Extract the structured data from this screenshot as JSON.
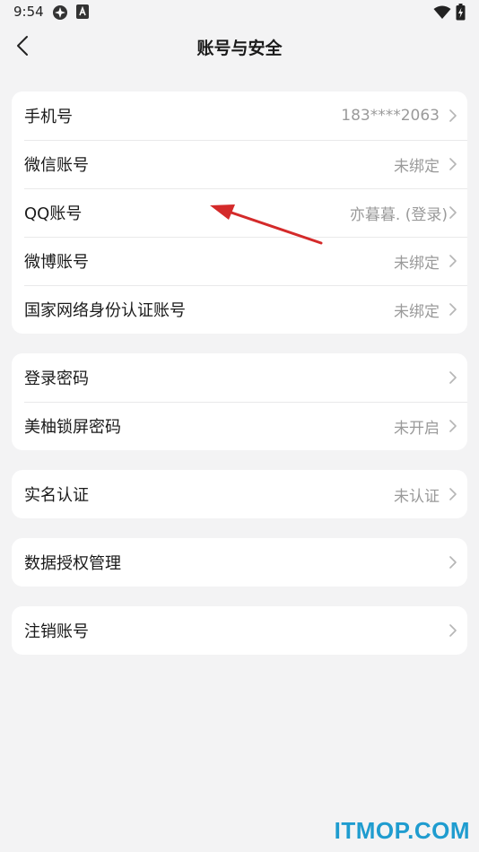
{
  "status_bar": {
    "time": "9:54"
  },
  "header": {
    "title": "账号与安全"
  },
  "groups": [
    {
      "rows": [
        {
          "label": "手机号",
          "value": "183****2063"
        },
        {
          "label": "微信账号",
          "value": "未绑定"
        },
        {
          "label": "QQ账号",
          "value": "亦暮暮. (登录)"
        },
        {
          "label": "微博账号",
          "value": "未绑定"
        },
        {
          "label": "国家网络身份认证账号",
          "value": "未绑定"
        }
      ]
    },
    {
      "rows": [
        {
          "label": "登录密码",
          "value": ""
        },
        {
          "label": "美柚锁屏密码",
          "value": "未开启"
        }
      ]
    },
    {
      "rows": [
        {
          "label": "实名认证",
          "value": "未认证"
        }
      ]
    },
    {
      "rows": [
        {
          "label": "数据授权管理",
          "value": ""
        }
      ]
    },
    {
      "rows": [
        {
          "label": "注销账号",
          "value": ""
        }
      ]
    }
  ],
  "watermark": "ITMOP.COM",
  "colors": {
    "background": "#f3f3f4",
    "card": "#ffffff",
    "secondary_text": "#9a9a9a",
    "annotation_arrow": "#d42a2a",
    "watermark": "#1f9ccf"
  }
}
